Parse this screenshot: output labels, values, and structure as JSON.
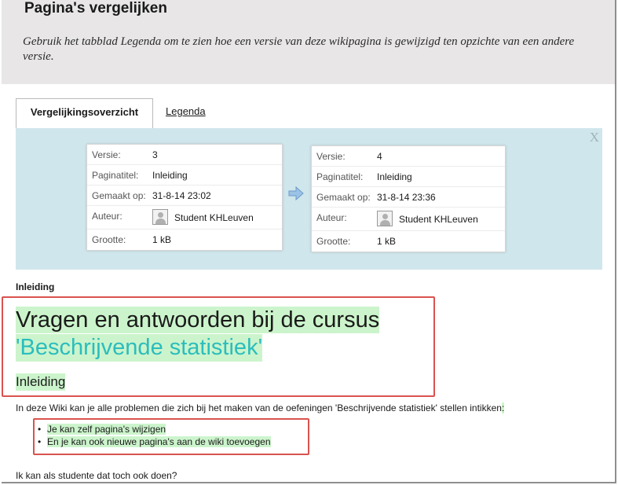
{
  "header": {
    "title": "Pagina's vergelijken",
    "description": "Gebruik het tabblad Legenda om te zien hoe een versie van deze wikipagina is gewijzigd ten opzichte van een andere versie."
  },
  "tabs": {
    "overview": "Vergelijkingsoverzicht",
    "legend": "Legenda"
  },
  "compare": {
    "close": "X",
    "labels": {
      "version": "Versie:",
      "title": "Paginatitel:",
      "created": "Gemaakt op:",
      "author": "Auteur:",
      "size": "Grootte:"
    },
    "left": {
      "version": "3",
      "title": "Inleiding",
      "created": "31-8-14 23:02",
      "author": "Student KHLeuven",
      "size": "1 kB"
    },
    "right": {
      "version": "4",
      "title": "Inleiding",
      "created": "31-8-14 23:36",
      "author": "Student KHLeuven",
      "size": "1 kB"
    }
  },
  "content": {
    "section_title": "Inleiding",
    "heading_line1": "Vragen en antwoorden bij de cursus",
    "heading_line2": "'Beschrijvende statistiek'",
    "subheading": "Inleiding",
    "paragraph": "In deze Wiki kan je alle problemen die zich bij het maken van de oefeningen 'Beschrijvende statistiek' stellen intikken",
    "paragraph_added": ":",
    "bullets": [
      "Je kan zelf pagina's wijzigen",
      "En je kan ook nieuwe pagina's aan de wiki toevoegen"
    ],
    "final_paragraph": "Ik kan als studente dat toch ook doen?"
  },
  "colors": {
    "header_bg": "#e8e6e6",
    "panel_bg": "#cfe6ec",
    "added_highlight": "#ccf4cc",
    "annotation_box": "#d9534f",
    "heading_accent": "#2bbdbd"
  }
}
